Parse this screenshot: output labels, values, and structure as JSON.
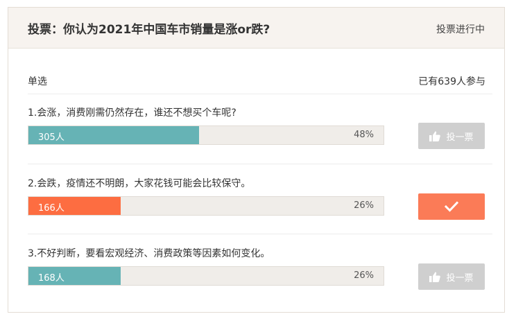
{
  "header": {
    "title": "投票：你认为2021年中国车市销量是涨or跌?",
    "status": "投票进行中"
  },
  "meta": {
    "mode": "单选",
    "participants": "已有639人参与"
  },
  "colors": {
    "teal": "#66b3b5",
    "orange": "#fd6d41",
    "button_grey": "#cfcfcf",
    "button_voted": "#fb7b57"
  },
  "options": [
    {
      "text": "1.会涨，消费刚需仍然存在，谁还不想买个车呢?",
      "count": "305人",
      "percent": "48%",
      "fraction": 0.48,
      "color": "#66b3b5",
      "button": {
        "label": "投一票",
        "icon": "thumbs-up-icon",
        "state": "disabled"
      }
    },
    {
      "text": "2.会跌，疫情还不明朗，大家花钱可能会比较保守。",
      "count": "166人",
      "percent": "26%",
      "fraction": 0.26,
      "color": "#fd6d41",
      "button": {
        "label": "",
        "icon": "checkmark-icon",
        "state": "voted"
      }
    },
    {
      "text": "3.不好判断，要看宏观经济、消费政策等因素如何变化。",
      "count": "168人",
      "percent": "26%",
      "fraction": 0.26,
      "color": "#66b3b5",
      "button": {
        "label": "投一票",
        "icon": "thumbs-up-icon",
        "state": "disabled"
      }
    }
  ]
}
